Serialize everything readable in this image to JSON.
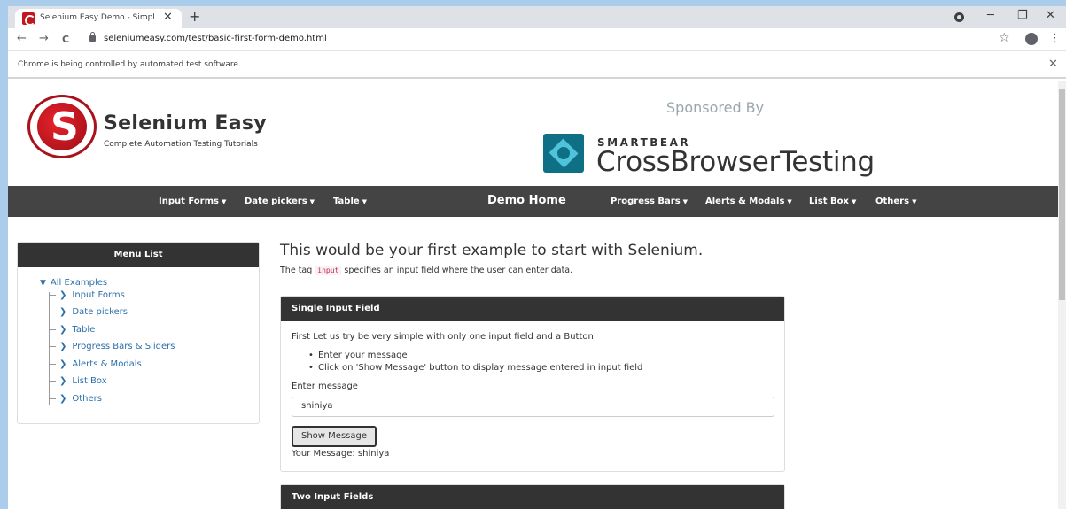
{
  "browser": {
    "tab_title": "Selenium Easy Demo - Simple Fo",
    "tab_close": "✕",
    "new_tab": "+",
    "url": "seleniumeasy.com/test/basic-first-form-demo.html",
    "infobar_text": "Chrome is being controlled by automated test software.",
    "infobar_close": "✕",
    "minimize": "─",
    "maximize": "❐",
    "close": "✕",
    "back": "←",
    "forward": "→",
    "reload": "C",
    "star": "☆",
    "menu": "⋮"
  },
  "header": {
    "brand_title": "Selenium Easy",
    "brand_tagline": "Complete Automation Testing Tutorials",
    "sponsored": "Sponsored By",
    "sponsor_top": "SMARTBEAR",
    "sponsor_name": "CrossBrowserTesting"
  },
  "navbar": {
    "items": [
      {
        "label": "Input Forms"
      },
      {
        "label": "Date pickers"
      },
      {
        "label": "Table"
      },
      {
        "label": "Progress Bars"
      },
      {
        "label": "Alerts & Modals"
      },
      {
        "label": "List Box"
      },
      {
        "label": "Others"
      }
    ],
    "home": "Demo Home",
    "caret": "▼"
  },
  "menu": {
    "title": "Menu List",
    "root": "All Examples",
    "items": [
      {
        "label": "Input Forms"
      },
      {
        "label": "Date pickers"
      },
      {
        "label": "Table"
      },
      {
        "label": "Progress Bars & Sliders"
      },
      {
        "label": "Alerts & Modals"
      },
      {
        "label": "List Box"
      },
      {
        "label": "Others"
      }
    ]
  },
  "main": {
    "title": "This would be your first example to start with Selenium.",
    "intro_before": "The tag ",
    "intro_code": "input",
    "intro_after": " specifies an input field where the user can enter data.",
    "card1": {
      "title": "Single Input Field",
      "lead": "First Let us try be very simple with only one input field and a Button",
      "bullets": [
        "Enter your message",
        "Click on 'Show Message' button to display message entered in input field"
      ],
      "field_label": "Enter message",
      "field_value": "shiniya",
      "button_label": "Show Message",
      "result": "Your Message: shiniya"
    },
    "card2": {
      "title": "Two Input Fields"
    }
  }
}
